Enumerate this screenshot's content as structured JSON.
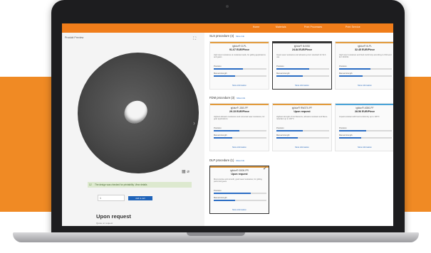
{
  "nav": {
    "items": [
      "Home",
      "Materials",
      "Print Processes",
      "Print Service"
    ]
  },
  "left_panel": {
    "title": "Produkt Preview",
    "green_note": "The design was checked for printability. View details",
    "quantity": "1",
    "cart_button": "Add to cart",
    "price": "Upon request",
    "price_note": "Quote on request"
  },
  "sections": [
    {
      "title": "SLS procedure (4)",
      "more": "More Info",
      "cards": [
        {
          "name": "iglidur® i3-PL",
          "price": "91.07 EUR/Piece",
          "desc": "High wear resistance at moderate loads, for gliding applications and gears",
          "lbl1": "Precision",
          "p1": 0.55,
          "lbl2": "Manual strength",
          "p2": 0.4,
          "link": "More information",
          "accent": "#e29a3a",
          "selected": false
        },
        {
          "name": "iglidur® i6-BSD",
          "price": "24.84 EUR/Piece",
          "desc": "Gears wear resistance and abrasion-proof, standard for SLS use",
          "lbl1": "Precision",
          "p1": 0.62,
          "lbl2": "Manual strength",
          "p2": 0.5,
          "link": "More information",
          "accent": "#333333",
          "selected": true
        },
        {
          "name": "iglidur® i6-PL",
          "price": "32.45 EUR/Piece",
          "desc": "High wear resistance and food conformity according to FDA and EU 10/2011",
          "lbl1": "Precision",
          "p1": 0.6,
          "lbl2": "Manual strength",
          "p2": 0.45,
          "link": "More information",
          "accent": "#e29a3a",
          "selected": false
        }
      ]
    },
    {
      "title": "FDM procedure (3)",
      "more": "More Info",
      "cards": [
        {
          "name": "iglidur® J260-PF",
          "price": "29.15 EUR/Piece",
          "desc": "Highest abrasion resistance and universal wear resistance, for gear applications",
          "lbl1": "Precision",
          "p1": 0.48,
          "lbl2": "Manual strength",
          "p2": 0.35,
          "link": "More information",
          "accent": "#e29a3a",
          "selected": false
        },
        {
          "name": "iglidur® RW370-PF",
          "price": "Upon request",
          "desc": "Highest strength of iris filaments, abrasion-resistant and flame-retardant up to 100°C",
          "lbl1": "Precision",
          "p1": 0.5,
          "lbl2": "Manual strength",
          "p2": 0.4,
          "link": "More information",
          "accent": "#e29a3a",
          "selected": false
        },
        {
          "name": "iglidur® A350-PF",
          "price": "28.56 EUR/Piece",
          "desc": "Impact-resistant with food conformity up to 100°C",
          "lbl1": "Precision",
          "p1": 0.52,
          "lbl2": "Manual strength",
          "p2": 0.42,
          "link": "More information",
          "accent": "#4aa3d8",
          "selected": false
        }
      ]
    },
    {
      "title": "DLP procedure (1)",
      "more": "More Info",
      "cards": [
        {
          "name": "iglidur® i3000-PR",
          "price": "Upon request",
          "desc": "Most precise and smooth, good wear resistance, for gliding parts and gears",
          "lbl1": "Precision",
          "p1": 0.7,
          "lbl2": "Manual strength",
          "p2": 0.4,
          "link": "More information",
          "accent": "#e29a3a",
          "selected": true
        }
      ]
    }
  ]
}
